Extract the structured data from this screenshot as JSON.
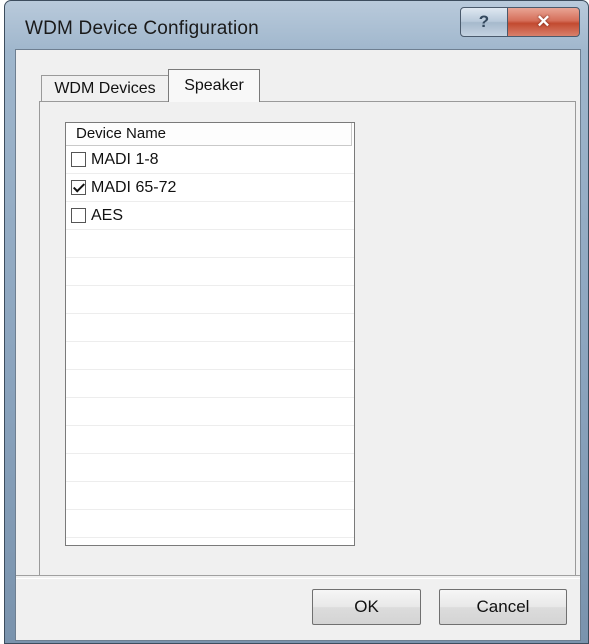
{
  "window": {
    "title": "WDM Device Configuration",
    "help_label": "?",
    "close_label": "✕"
  },
  "tabs": [
    {
      "label": "WDM Devices",
      "selected": false
    },
    {
      "label": "Speaker",
      "selected": true
    }
  ],
  "list": {
    "header": "Device Name",
    "items": [
      {
        "label": "MADI 1-8",
        "checked": false
      },
      {
        "label": "MADI 65-72",
        "checked": true
      },
      {
        "label": "AES",
        "checked": false
      }
    ]
  },
  "buttons": {
    "ok_label": "OK",
    "cancel_label": "Cancel"
  }
}
